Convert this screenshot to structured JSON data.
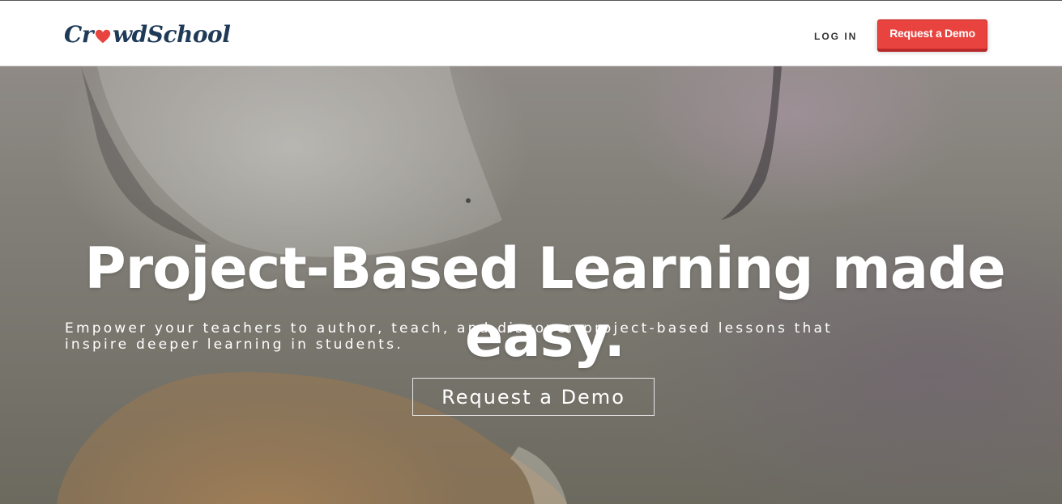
{
  "nav": {
    "logo_text_before": "Cr",
    "logo_text_after": "wdSchool",
    "login_label": "LOG IN",
    "demo_button_label": "Request a Demo"
  },
  "hero": {
    "title": "Project-Based Learning made easy.",
    "subtitle": "Empower your teachers to author, teach, and discover project-based lessons that inspire deeper learning in students.",
    "cta_label": "Request a Demo"
  },
  "colors": {
    "brand_red": "#e8433f",
    "logo_navy": "#1f3a57"
  }
}
